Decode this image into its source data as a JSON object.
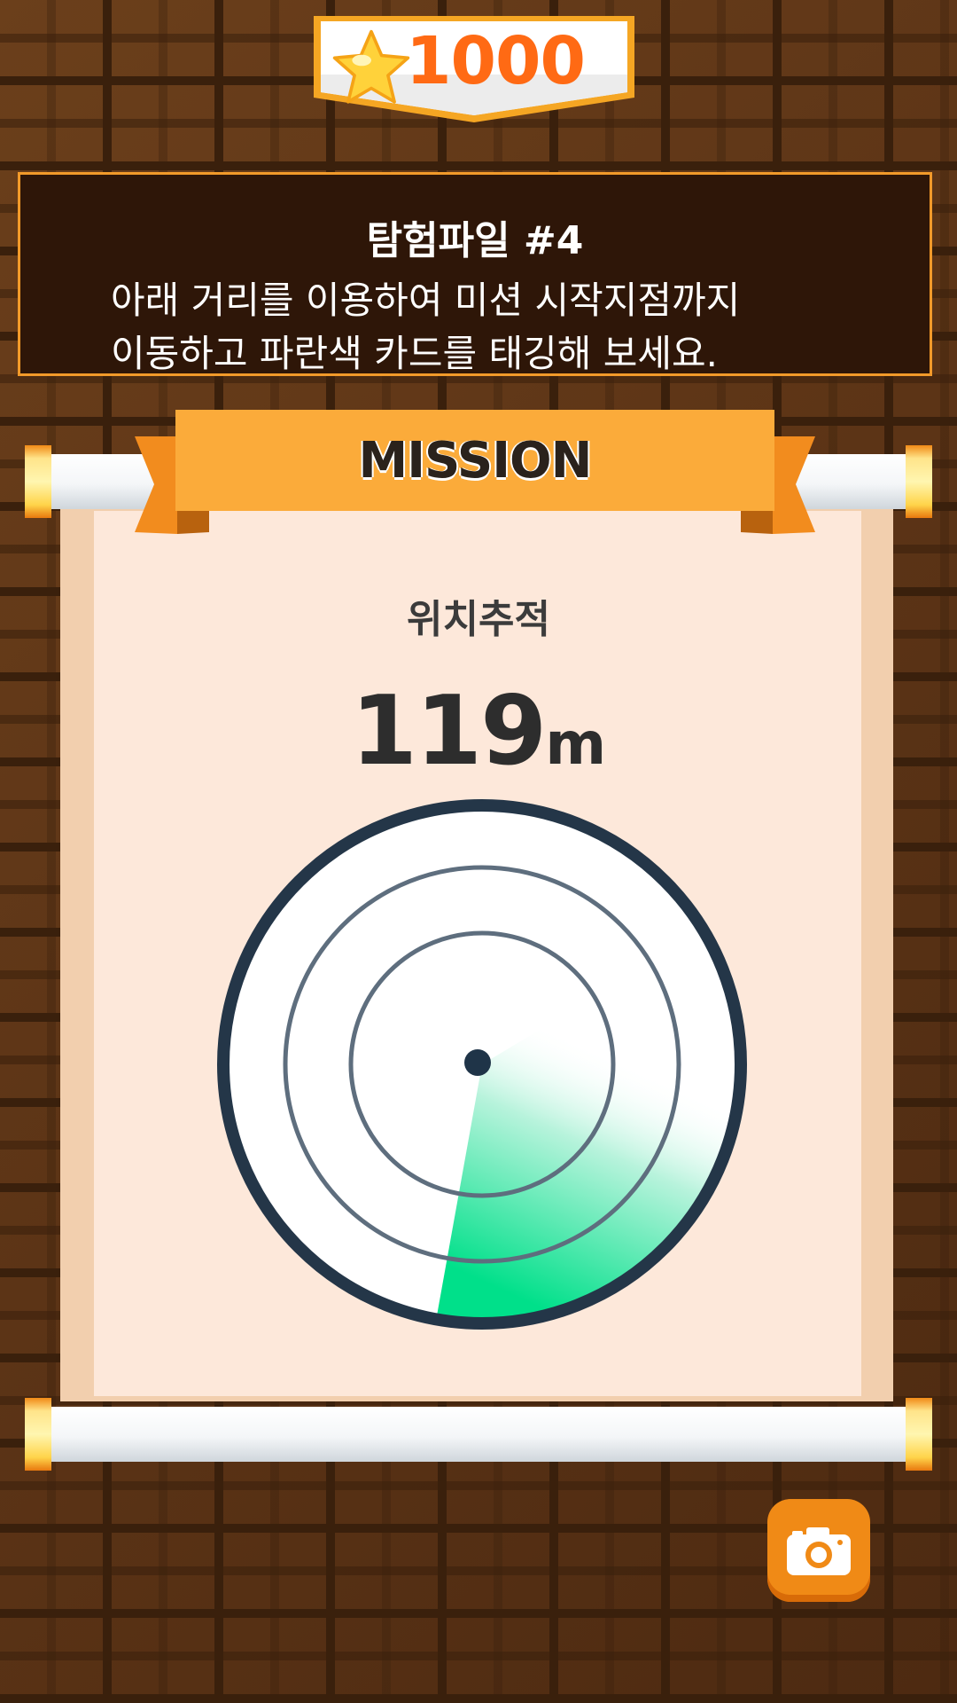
{
  "score": {
    "value": "1000",
    "icon": "star-icon"
  },
  "mission_info": {
    "title": "탐험파일 #4",
    "instructions": "아래 거리를 이용하여 미션 시작지점까지\n이동하고 파란색 카드를 태깅해 보세요."
  },
  "mission_banner": {
    "label": "MISSION"
  },
  "tracker": {
    "label": "위치추적",
    "distance": "119",
    "unit": "m"
  },
  "camera_button": {
    "icon": "camera-icon"
  },
  "colors": {
    "score_text": "#ff6a14",
    "banner": "#fbab3a",
    "radar_sweep": "#00e08a",
    "radar_ring": "#1f3448"
  }
}
